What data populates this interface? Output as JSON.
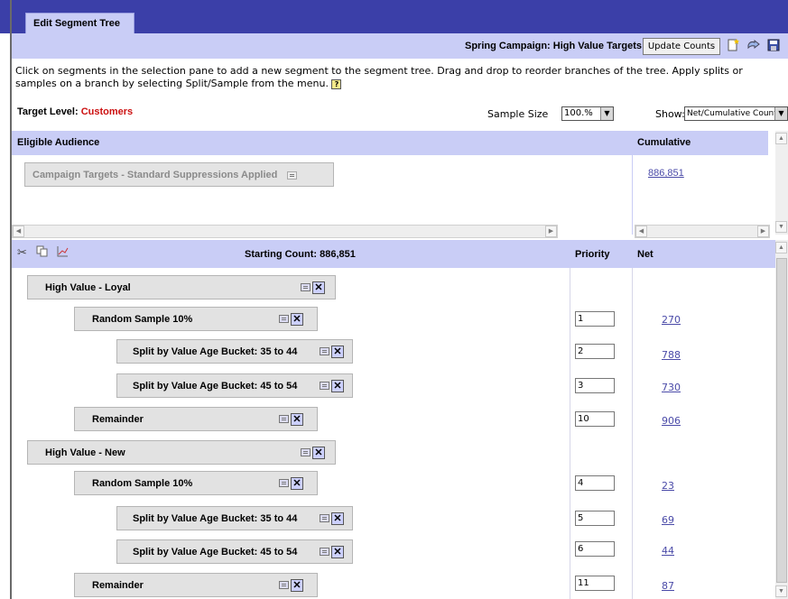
{
  "tab": {
    "label": "Edit Segment Tree"
  },
  "toolbar": {
    "campaign_title": "Spring Campaign: High Value Targets",
    "update_label": "Update Counts",
    "new_icon": "new-document-icon",
    "open_icon": "open-icon",
    "save_icon": "save-icon"
  },
  "instructions": {
    "text": "Click on segments in the selection pane to add a new segment to the segment tree. Drag and drop to reorder branches of the tree. Apply splits or samples on a branch by selecting Split/Sample from the menu."
  },
  "target": {
    "label": "Target Level:",
    "value": "Customers"
  },
  "sample_size": {
    "label": "Sample Size",
    "value": "100.%"
  },
  "show": {
    "label": "Show:",
    "value": "Net/Cumulative Counts"
  },
  "eligible": {
    "title": "Eligible Audience",
    "cumulative_title": "Cumulative",
    "campaign_targets": "Campaign Targets - Standard Suppressions Applied",
    "cumulative_value": "886,851"
  },
  "segments_header": {
    "starting_count": "Starting Count:  886,851",
    "priority_title": "Priority",
    "net_title": "Net"
  },
  "rows": [
    {
      "label": "High Value - Loyal",
      "priority": "",
      "net": ""
    },
    {
      "label": "Random Sample 10%",
      "priority": "1",
      "net": "270"
    },
    {
      "label": "Split by Value Age Bucket: 35 to 44",
      "priority": "2",
      "net": "788"
    },
    {
      "label": "Split by Value Age Bucket: 45 to 54",
      "priority": "3",
      "net": "730"
    },
    {
      "label": "Remainder",
      "priority": "10",
      "net": "906"
    },
    {
      "label": "High Value - New",
      "priority": "",
      "net": ""
    },
    {
      "label": "Random Sample 10%",
      "priority": "4",
      "net": "23"
    },
    {
      "label": "Split by Value Age Bucket: 35 to 44",
      "priority": "5",
      "net": "69"
    },
    {
      "label": "Split by Value Age Bucket: 45 to 54",
      "priority": "6",
      "net": "44"
    },
    {
      "label": "Remainder",
      "priority": "11",
      "net": "87"
    }
  ],
  "colors": {
    "header_bar": "#3b3fa8",
    "pane_header": "#c9cdf6",
    "target_value": "#cc1111",
    "link": "#4a4aa8"
  }
}
